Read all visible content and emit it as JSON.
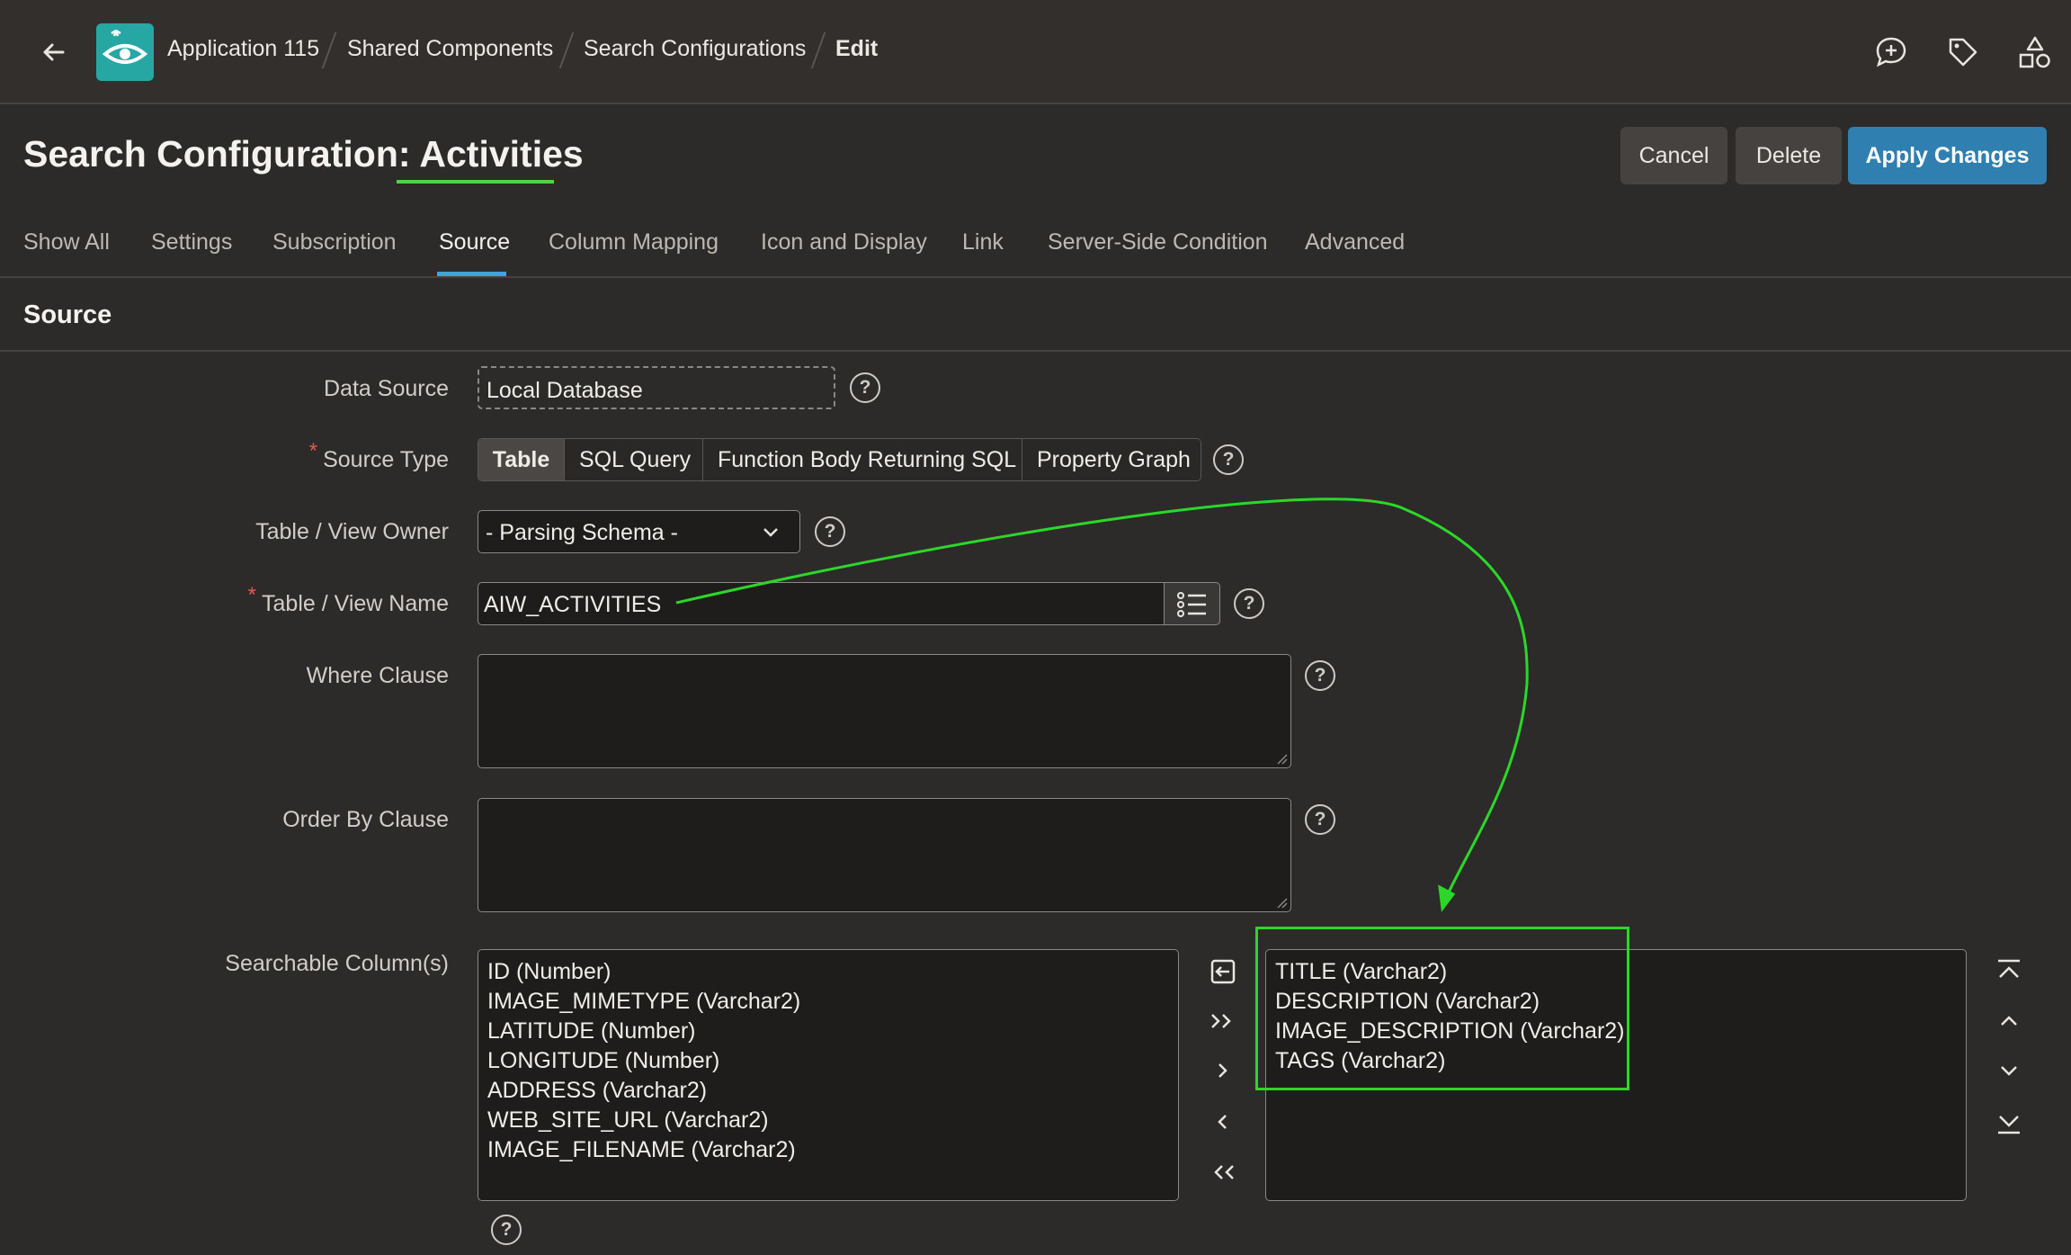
{
  "header": {
    "breadcrumbs": [
      "Application 115",
      "Shared Components",
      "Search Configurations",
      "Edit"
    ],
    "icons": [
      "back-arrow-icon",
      "app-logo-icon",
      "feedback-chat-icon",
      "tag-icon",
      "shapes-icon"
    ]
  },
  "page": {
    "title_prefix": "Search Configuration: ",
    "title_name": "Activities",
    "buttons": {
      "cancel": "Cancel",
      "delete": "Delete",
      "apply": "Apply Changes"
    }
  },
  "tabs": [
    {
      "label": "Show All",
      "active": false
    },
    {
      "label": "Settings",
      "active": false
    },
    {
      "label": "Subscription",
      "active": false
    },
    {
      "label": "Source",
      "active": true
    },
    {
      "label": "Column Mapping",
      "active": false
    },
    {
      "label": "Icon and Display",
      "active": false
    },
    {
      "label": "Link",
      "active": false
    },
    {
      "label": "Server-Side Condition",
      "active": false
    },
    {
      "label": "Advanced",
      "active": false
    }
  ],
  "region": {
    "title": "Source",
    "fields": {
      "data_source": {
        "label": "Data Source",
        "value": "Local Database"
      },
      "source_type": {
        "label": "Source Type",
        "required_mark": "*",
        "options": [
          "Table",
          "SQL Query",
          "Function Body Returning SQL",
          "Property Graph"
        ],
        "selected": "Table"
      },
      "owner": {
        "label": "Table / View Owner",
        "value": "- Parsing Schema -"
      },
      "table_name": {
        "label": "Table / View Name",
        "required_mark": "*",
        "value": "AIW_ACTIVITIES"
      },
      "where": {
        "label": "Where Clause",
        "value": ""
      },
      "order_by": {
        "label": "Order By Clause",
        "value": ""
      },
      "searchable": {
        "label": "Searchable Column(s)",
        "available": [
          "ID (Number)",
          "IMAGE_MIMETYPE (Varchar2)",
          "LATITUDE (Number)",
          "LONGITUDE (Number)",
          "ADDRESS (Varchar2)",
          "WEB_SITE_URL (Varchar2)",
          "IMAGE_FILENAME (Varchar2)"
        ],
        "selected": [
          "TITLE (Varchar2)",
          "DESCRIPTION (Varchar2)",
          "IMAGE_DESCRIPTION (Varchar2)",
          "TAGS (Varchar2)"
        ]
      }
    },
    "help_glyph": "?"
  },
  "colors": {
    "accent_green": "#2bd829",
    "primary_blue": "#2f7fb0",
    "tab_blue": "#3ea5d8",
    "logo_teal": "#27a7a4"
  }
}
